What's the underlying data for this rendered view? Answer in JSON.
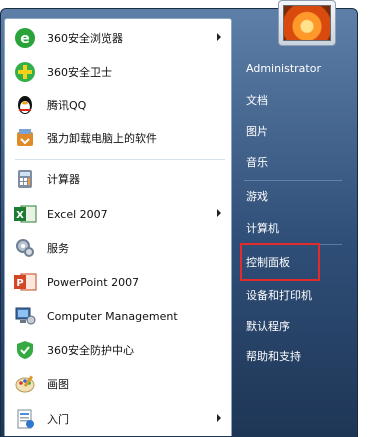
{
  "left_items": [
    {
      "label": "360安全浏览器",
      "icon": "360-browser-icon",
      "arrow": true
    },
    {
      "label": "360安全卫士",
      "icon": "360-security-icon",
      "arrow": false
    },
    {
      "label": "腾讯QQ",
      "icon": "qq-penguin-icon",
      "arrow": false
    },
    {
      "label": "强力卸载电脑上的软件",
      "icon": "uninstall-icon",
      "arrow": false
    },
    {
      "label": "计算器",
      "icon": "calculator-icon",
      "arrow": false
    },
    {
      "label": "Excel 2007",
      "icon": "excel-icon",
      "arrow": true
    },
    {
      "label": "服务",
      "icon": "services-icon",
      "arrow": false
    },
    {
      "label": "PowerPoint 2007",
      "icon": "powerpoint-icon",
      "arrow": false
    },
    {
      "label": "Computer Management",
      "icon": "computer-management-icon",
      "arrow": false
    },
    {
      "label": "360安全防护中心",
      "icon": "360-protection-icon",
      "arrow": false
    },
    {
      "label": "画图",
      "icon": "paint-icon",
      "arrow": false
    },
    {
      "label": "入门",
      "icon": "getting-started-icon",
      "arrow": true
    }
  ],
  "right_items": [
    {
      "label": "Administrator"
    },
    {
      "label": "文档"
    },
    {
      "label": "图片"
    },
    {
      "label": "音乐"
    },
    {
      "label": "游戏"
    },
    {
      "label": "计算机"
    },
    {
      "label": "控制面板"
    },
    {
      "label": "设备和打印机"
    },
    {
      "label": "默认程序"
    },
    {
      "label": "帮助和支持"
    }
  ],
  "colors": {
    "highlight_border": "#e32b2b",
    "panel_blue": "#2f4e77"
  }
}
